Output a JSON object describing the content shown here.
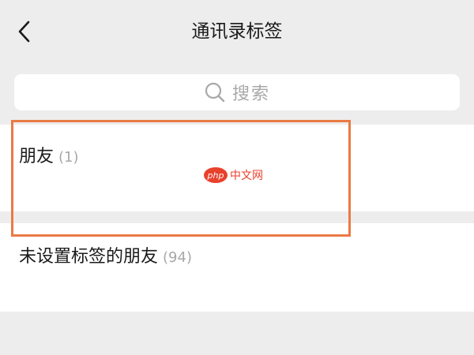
{
  "header": {
    "title": "通讯录标签",
    "back_icon": "chevron-left-icon"
  },
  "search": {
    "placeholder": "搜索",
    "icon": "search-icon"
  },
  "tags": [
    {
      "label": "朋友",
      "count": "(1)"
    },
    {
      "label": "未设置标签的朋友",
      "count": "(94)"
    }
  ],
  "watermark": {
    "logo_text": "php",
    "site_text": "中文网"
  },
  "colors": {
    "background": "#ededed",
    "card": "#ffffff",
    "highlight_border": "#ea7a45",
    "secondary_text": "#a8a8a8",
    "watermark": "#e8412c"
  }
}
